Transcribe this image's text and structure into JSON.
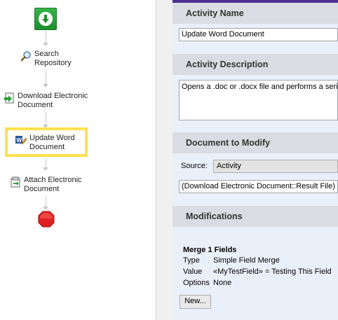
{
  "workflow": {
    "steps": [
      {
        "label_line1": "Search",
        "label_line2": "Repository",
        "icon": "magnifier-icon"
      },
      {
        "label_line1": "Download Electronic",
        "label_line2": "Document",
        "icon": "download-document-icon"
      },
      {
        "label_line1": "Update Word",
        "label_line2": "Document",
        "icon": "word-document-edit-icon"
      },
      {
        "label_line1": "Attach Electronic",
        "label_line2": "Document",
        "icon": "attach-document-icon"
      }
    ],
    "start_icon": "down-arrow-icon",
    "end_icon": "stop-octagon-icon",
    "highlight_color": "#ffe14d"
  },
  "panel": {
    "activity_name": {
      "header": "Activity Name",
      "value": "Update Word Document"
    },
    "activity_description": {
      "header": "Activity Description",
      "value": "Opens a .doc or .docx file and performs a series"
    },
    "document_to_modify": {
      "header": "Document to Modify",
      "source_label": "Source:",
      "source_value": "Activity",
      "result_value": "(Download Electronic Document::Result File)"
    },
    "modifications": {
      "header": "Modifications",
      "item_title": "Merge  1 Fields",
      "rows": [
        {
          "key": "Type",
          "value": "Simple Field Merge"
        },
        {
          "key": "Value",
          "value": "«MyTestField» = Testing This Field"
        },
        {
          "key": "Options",
          "value": "None"
        }
      ],
      "new_button": "New..."
    }
  },
  "colors": {
    "accent_bar": "#4b2f8f",
    "panel_bg": "#eaf0f9",
    "header_bg": "#d9dde3"
  }
}
